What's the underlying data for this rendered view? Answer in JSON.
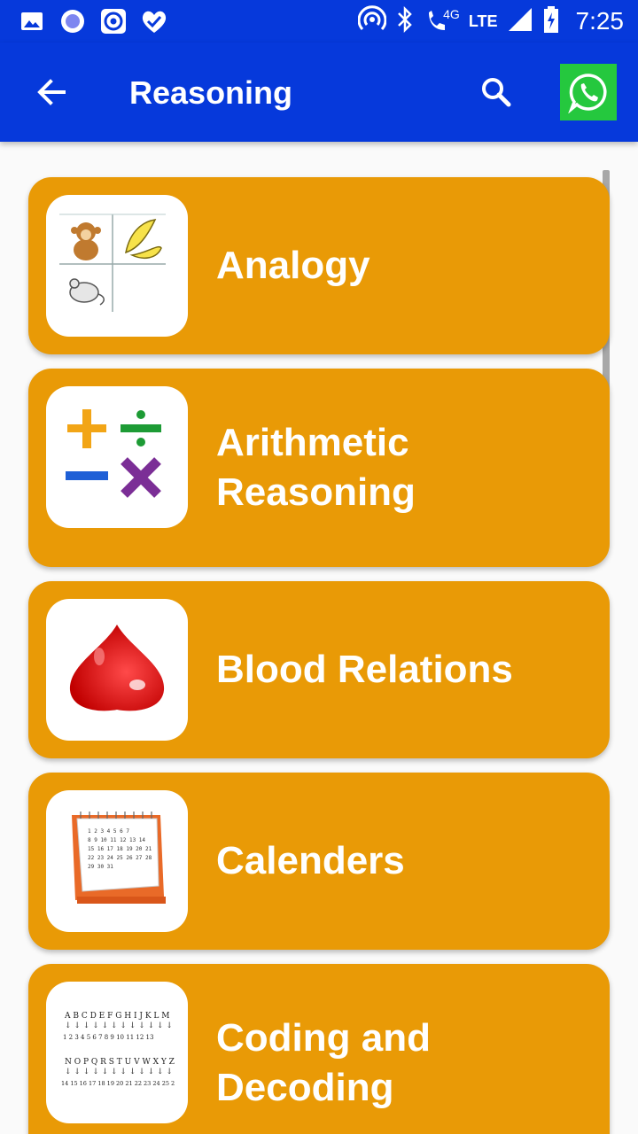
{
  "status_bar": {
    "time": "7:25",
    "network": "4G",
    "network2": "LTE",
    "icons": [
      "image-icon",
      "record-icon",
      "target-icon",
      "heart-check-icon",
      "hotspot-icon",
      "bluetooth-icon",
      "wifi-call-icon",
      "signal-icon",
      "battery-icon"
    ]
  },
  "app_bar": {
    "title": "Reasoning",
    "back_icon": "arrow-left-icon",
    "search_icon": "search-icon",
    "whatsapp_icon": "whatsapp-icon"
  },
  "colors": {
    "primary": "#0639db",
    "card": "#e99a06",
    "whatsapp": "#25c83e"
  },
  "items": [
    {
      "label": "Analogy",
      "icon": "monkey-banana-mouse-icon"
    },
    {
      "label": "Arithmetic Reasoning",
      "icon": "math-operators-icon"
    },
    {
      "label": "Blood Relations",
      "icon": "blood-drop-icon"
    },
    {
      "label": "Calenders",
      "icon": "calendar-icon"
    },
    {
      "label": "Coding and Decoding",
      "icon": "alphabet-code-icon"
    }
  ]
}
